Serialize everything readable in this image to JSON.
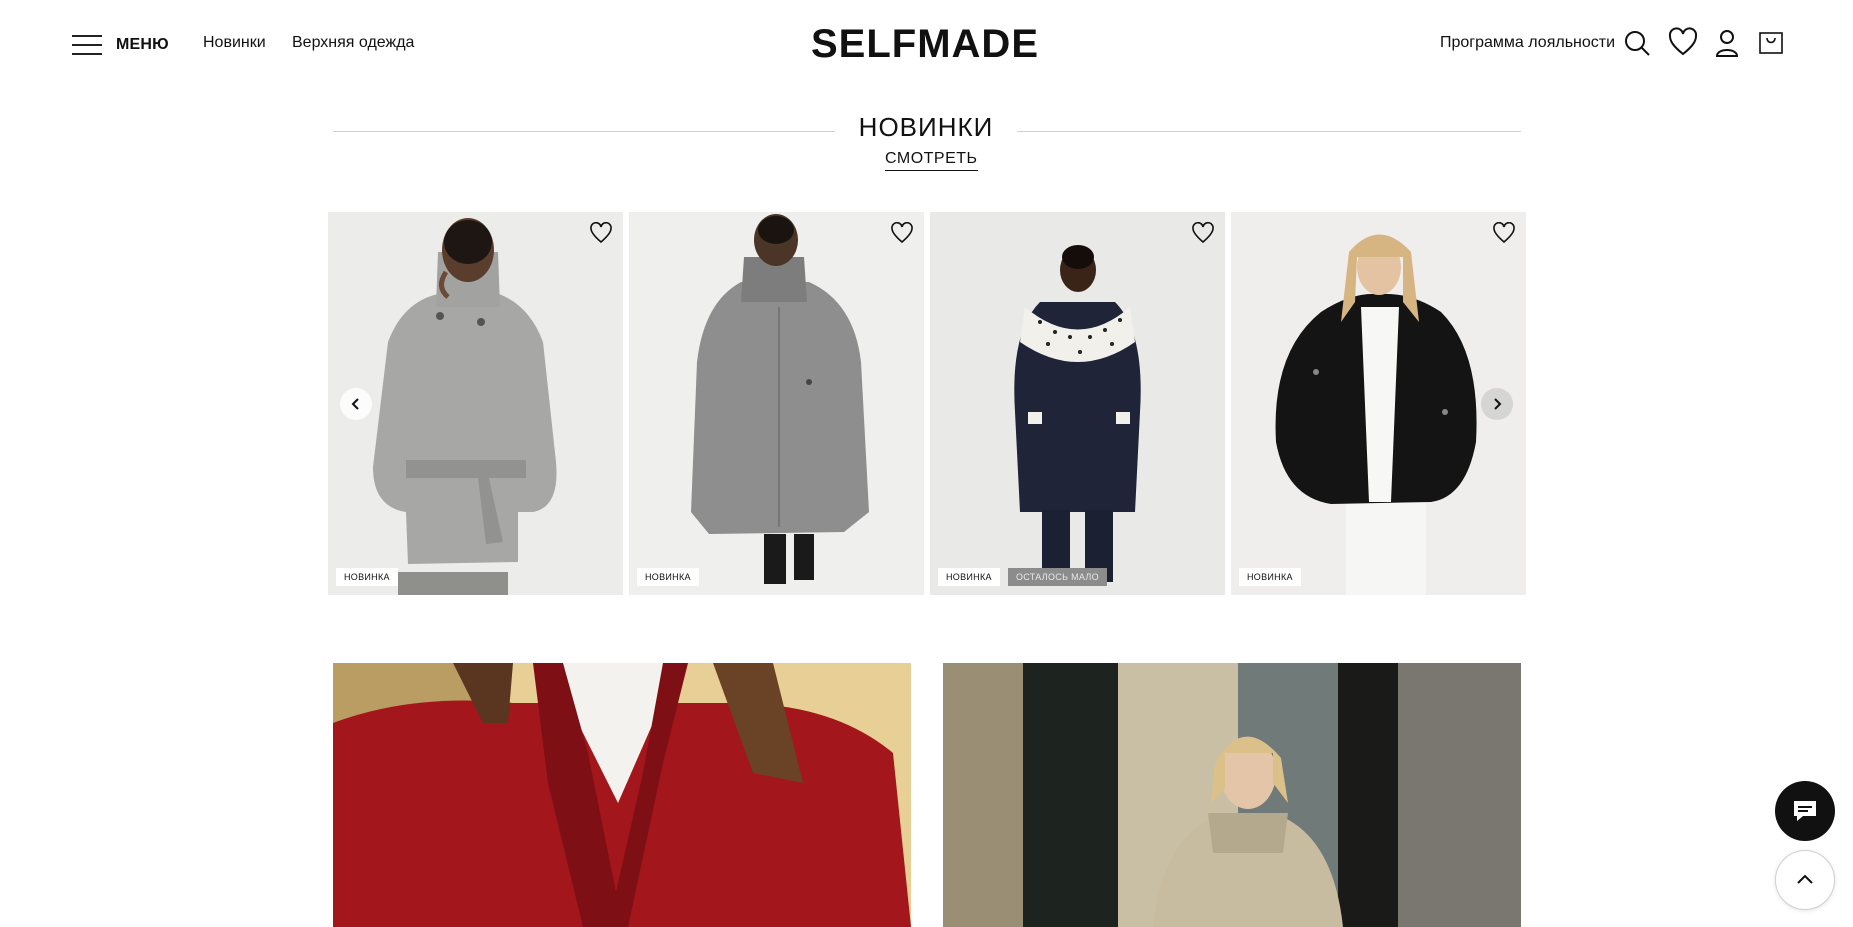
{
  "header": {
    "menu_label": "МЕНЮ",
    "nav": [
      "Новинки",
      "Верхняя одежда"
    ],
    "logo": "SELFMADE",
    "loyalty": "Программа лояльности",
    "icons": [
      "search-icon",
      "heart-icon",
      "user-icon",
      "cart-icon"
    ]
  },
  "section": {
    "title": "НОВИНКИ",
    "link": "СМОТРЕТЬ"
  },
  "products": [
    {
      "badges": [
        "НОВИНКА"
      ],
      "image": "model-grey-belted-coat"
    },
    {
      "badges": [
        "НОВИНКА"
      ],
      "image": "model-grey-long-coat"
    },
    {
      "badges": [
        "НОВИНКА",
        "ОСТАЛОСЬ МАЛО"
      ],
      "image": "model-navy-coat-polka-scarf"
    },
    {
      "badges": [
        "НОВИНКА"
      ],
      "image": "model-black-bomber-jacket"
    }
  ],
  "banners": [
    "red-blazer-editorial",
    "beige-jacket-street-editorial"
  ],
  "colors": {
    "text": "#111111",
    "badge_few_bg": "#8c8c8c",
    "divider": "#d0d0d0"
  }
}
